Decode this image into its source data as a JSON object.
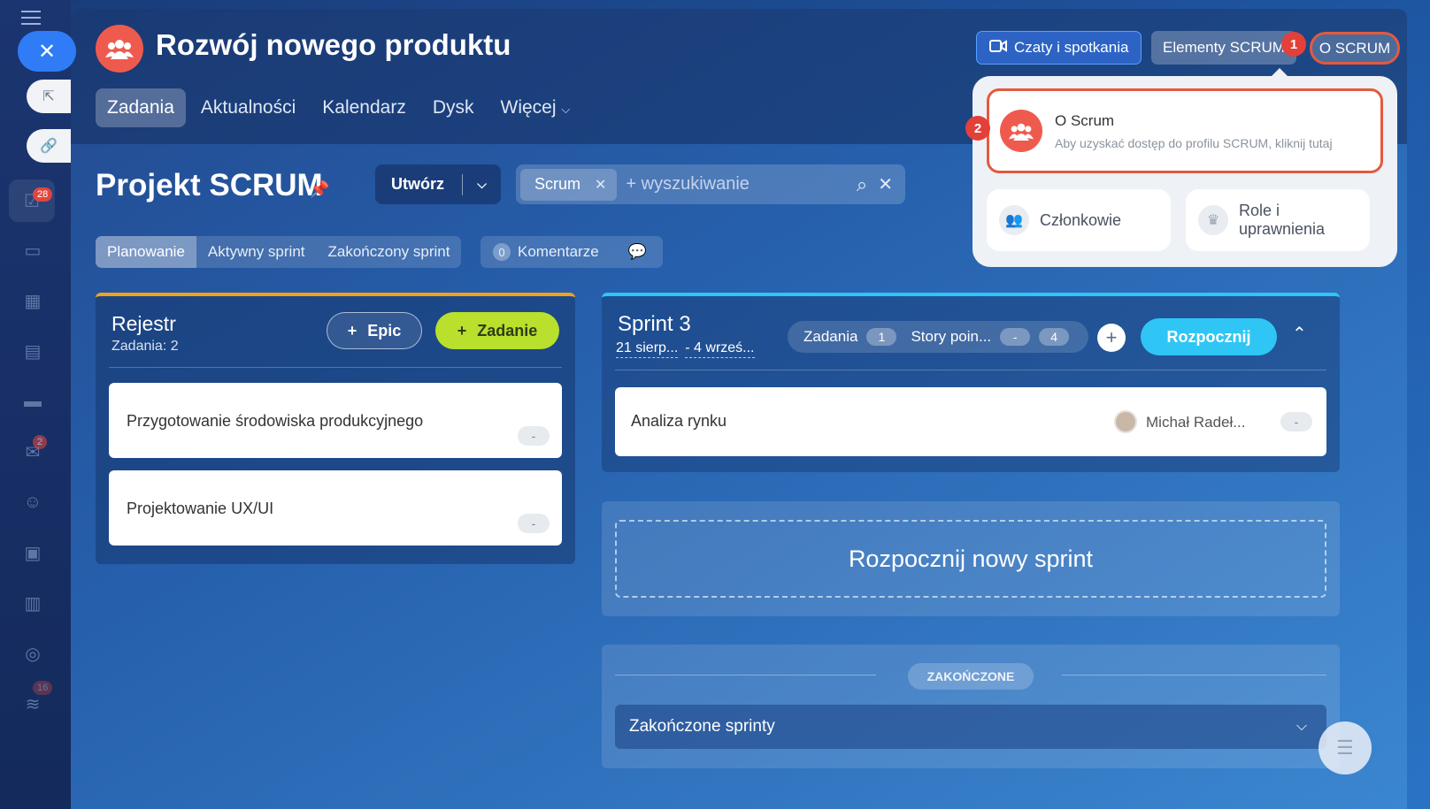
{
  "rail": {
    "badges": {
      "tasks": "28",
      "mail": "2",
      "other": "16"
    }
  },
  "header": {
    "title": "Rozwój nowego produktu",
    "tabs": [
      {
        "label": "Zadania"
      },
      {
        "label": "Aktualności"
      },
      {
        "label": "Kalendarz"
      },
      {
        "label": "Dysk"
      },
      {
        "label": "Więcej"
      }
    ],
    "chat_button": "Czaty i spotkania",
    "elements_button": "Elementy SCRUM",
    "about_button": "O SCRUM",
    "more_button": "•••"
  },
  "steps": {
    "one": "1",
    "two": "2"
  },
  "popup": {
    "about_title": "O Scrum",
    "about_sub": "Aby uzyskać dostęp do profilu SCRUM, kliknij tutaj",
    "members": "Członkowie",
    "roles_line1": "Role i",
    "roles_line2": "uprawnienia"
  },
  "project": {
    "title": "Projekt SCRUM",
    "create_button": "Utwórz",
    "search_chip": "Scrum",
    "search_placeholder": "+ wyszukiwanie",
    "subtabs": [
      {
        "label": "Planowanie"
      },
      {
        "label": "Aktywny sprint"
      },
      {
        "label": "Zakończony sprint"
      }
    ],
    "comments_count": "0",
    "comments_label": "Komentarze"
  },
  "backlog": {
    "title": "Rejestr",
    "count": "Zadania: 2",
    "epic_button": "Epic",
    "task_button": "Zadanie",
    "tasks": [
      {
        "title": "Przygotowanie środowiska produkcyjnego",
        "points": "-"
      },
      {
        "title": "Projektowanie UX/UI",
        "points": "-"
      }
    ]
  },
  "sprint": {
    "title": "Sprint 3",
    "date_start": "21 sierp...",
    "date_end": "- 4 wrześ...",
    "tasks_label": "Zadania",
    "tasks_count": "1",
    "points_label": "Story poin...",
    "points_done": "-",
    "points_total": "4",
    "start_button": "Rozpocznij",
    "task": {
      "title": "Analiza rynku",
      "assignee": "Michał Radeł...",
      "points": "-"
    }
  },
  "new_sprint": "Rozpocznij nowy sprint",
  "finished": {
    "label": "ZAKOŃCZONE",
    "row": "Zakończone sprinty"
  },
  "colors": {
    "accent_red": "#e35a3e",
    "task_green": "#b8e02c",
    "sprint_blue": "#2fc6f6",
    "backlog_orange": "#f1a21a"
  }
}
